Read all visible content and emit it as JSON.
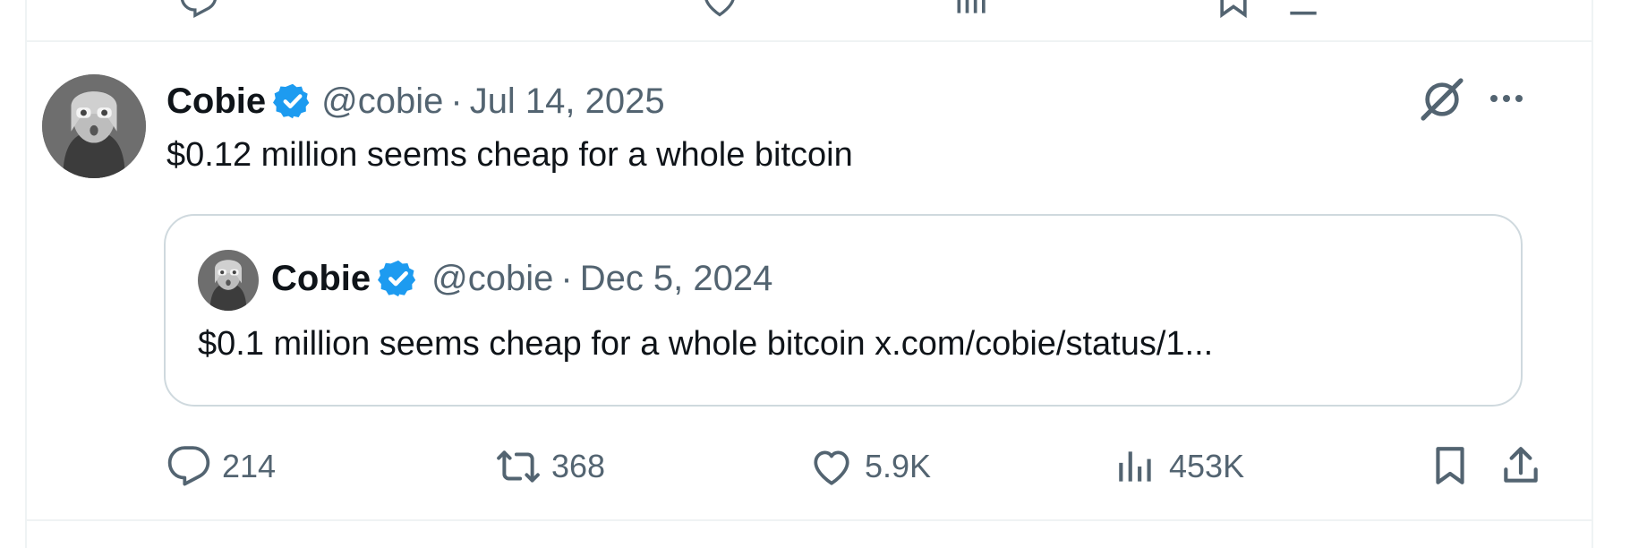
{
  "tweet": {
    "author_name": "Cobie",
    "handle": "@cobie",
    "separator": "·",
    "date": "Jul 14, 2025",
    "text": "$0.12 million seems cheap for a whole bitcoin",
    "icons": {
      "verified": "verified-badge-icon",
      "grok": "grok-icon",
      "more": "more-icon"
    },
    "quote": {
      "author_name": "Cobie",
      "handle": "@cobie",
      "separator": "·",
      "date": "Dec 5, 2024",
      "text": "$0.1 million seems cheap for a whole bitcoin x.com/cobie/status/1..."
    },
    "actions": {
      "replies": "214",
      "reposts": "368",
      "likes": "5.9K",
      "views": "453K"
    }
  },
  "colors": {
    "text_primary": "#0f1419",
    "text_secondary": "#536471",
    "verified_blue": "#1d9bf0",
    "border": "#cfd9de",
    "divider": "#eff3f4"
  }
}
